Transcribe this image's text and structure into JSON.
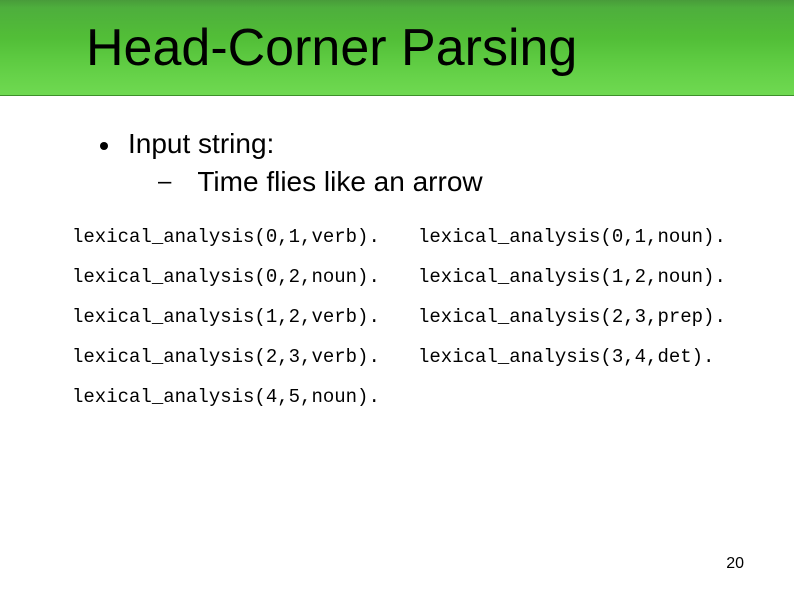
{
  "title": "Head-Corner Parsing",
  "bullet": {
    "label": "Input string:",
    "sub": "Time flies like an arrow"
  },
  "lexical": {
    "rows": [
      {
        "left": "lexical_analysis(0,1,verb).",
        "right": "lexical_analysis(0,1,noun)."
      },
      {
        "left": "lexical_analysis(0,2,noun).",
        "right": "lexical_analysis(1,2,noun)."
      },
      {
        "left": "lexical_analysis(1,2,verb).",
        "right": "lexical_analysis(2,3,prep)."
      },
      {
        "left": "lexical_analysis(2,3,verb).",
        "right": "lexical_analysis(3,4,det)."
      },
      {
        "left": "lexical_analysis(4,5,noun).",
        "right": ""
      }
    ]
  },
  "page_number": "20"
}
